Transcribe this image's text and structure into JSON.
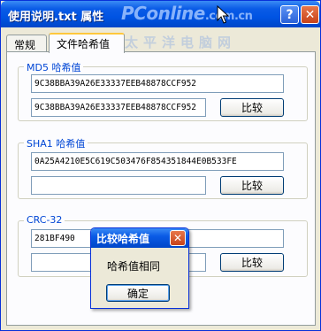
{
  "window": {
    "title": "使用说明.txt 属性",
    "help_label": "?",
    "close_label": "✕"
  },
  "watermark": {
    "brand": "PConline",
    "tld": ".com.cn",
    "chinese": "太平洋电脑网"
  },
  "tabs": [
    {
      "label": "常规",
      "active": false
    },
    {
      "label": "文件哈希值",
      "active": true
    }
  ],
  "md5": {
    "legend": "MD5 哈希值",
    "value": "9C38BBA39A26E33337EEB48878CCF952",
    "compare_value": "9C38BBA39A26E33337EEB48878CCF952",
    "compare_label": "比较"
  },
  "sha1": {
    "legend": "SHA1 哈希值",
    "value": "0A25A4210E5C619C503476F854351844E0B533FE",
    "compare_value": "",
    "compare_label": "比较"
  },
  "crc32": {
    "legend": "CRC-32",
    "value": "281BF490",
    "compare_value": "",
    "compare_label": "比较"
  },
  "dialog": {
    "title": "比较哈希值",
    "close_label": "✕",
    "message": "哈希值相同",
    "ok_label": "确定"
  },
  "colors": {
    "titlebar": "#0054e3",
    "legend_text": "#0046d5",
    "active_tab_accent": "#ffc83c",
    "close_button": "#c7431a"
  },
  "icons": {
    "cursor": "arrow-cursor-icon",
    "help": "help-icon",
    "close": "close-icon"
  }
}
